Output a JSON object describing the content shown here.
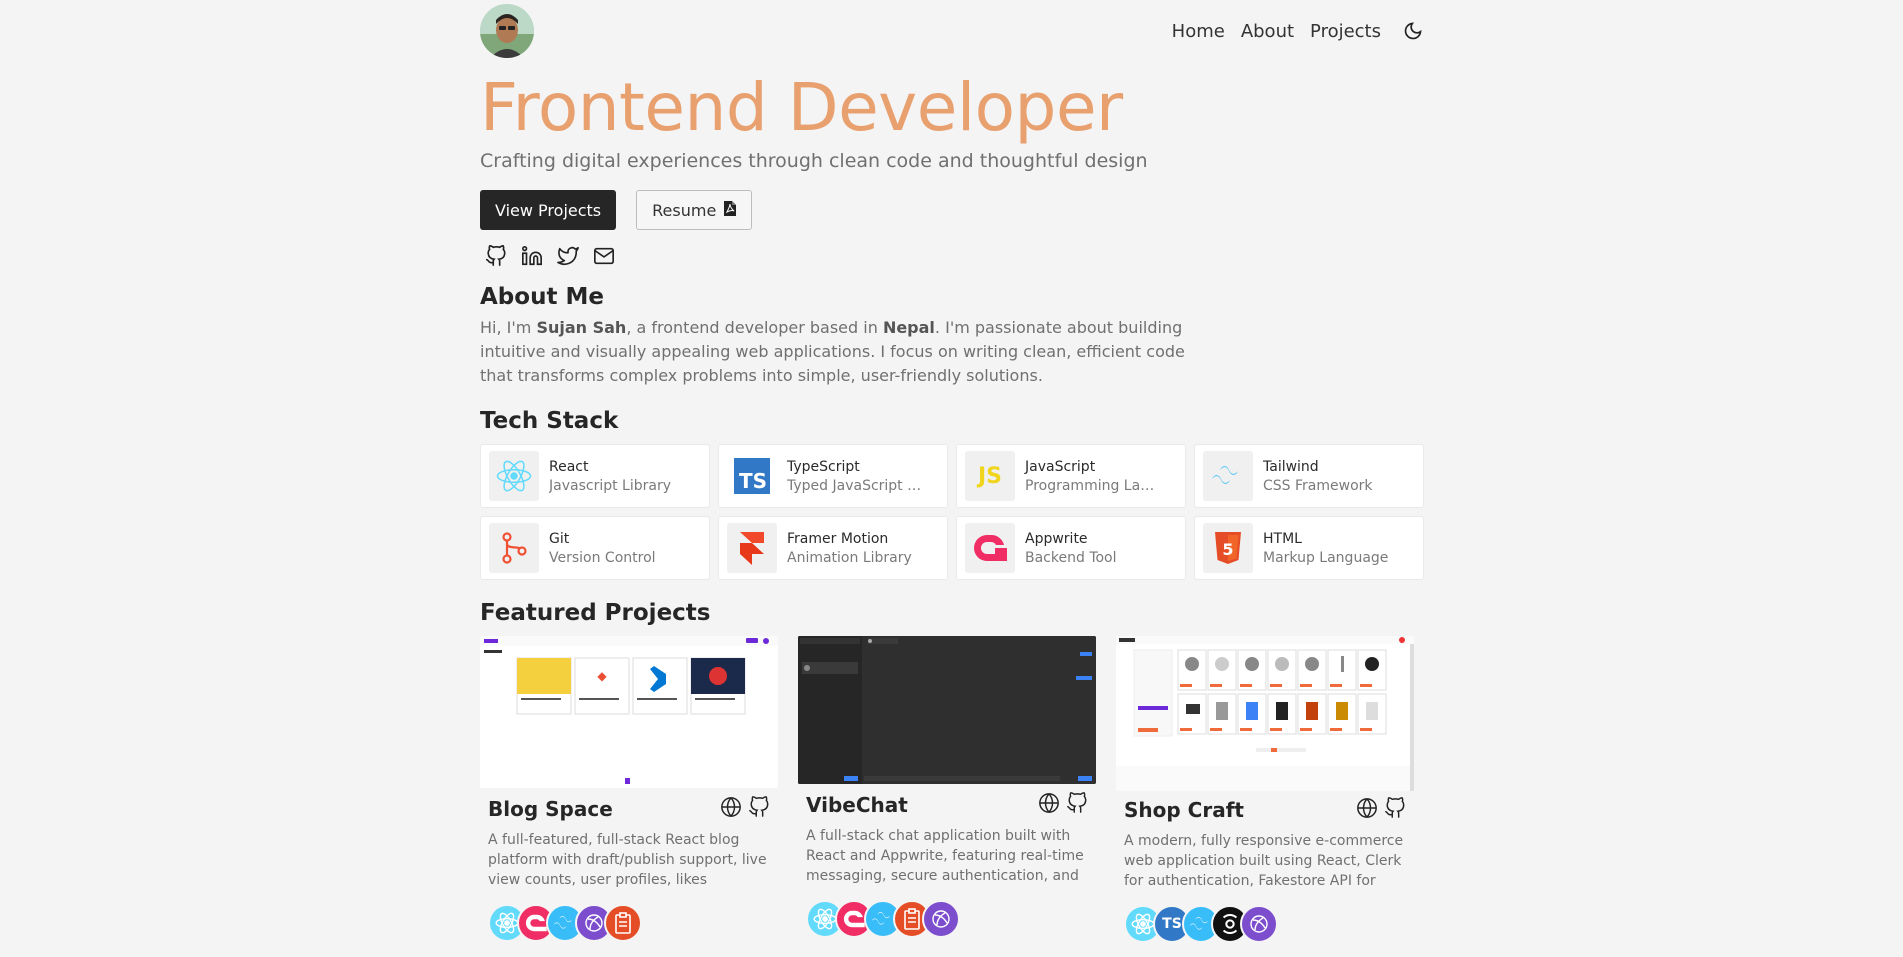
{
  "nav": {
    "links": [
      "Home",
      "About",
      "Projects"
    ],
    "theme_icon": "moon-icon"
  },
  "hero": {
    "title": "Frontend Developer",
    "subtitle": "Crafting digital experiences through clean code and thoughtful design",
    "view_projects": "View Projects",
    "resume": "Resume",
    "social_icons": [
      "github-icon",
      "linkedin-icon",
      "twitter-icon",
      "mail-icon"
    ]
  },
  "about": {
    "heading": "About Me",
    "intro": "Hi, I'm ",
    "name": "Sujan Sah",
    "mid": ", a frontend developer based in ",
    "place": "Nepal",
    "rest": ". I'm passionate about building intuitive and visually appealing web applications. I focus on writing clean, efficient code that transforms complex problems into simple, user-friendly solutions."
  },
  "tech": {
    "heading": "Tech Stack",
    "items": [
      {
        "name": "React",
        "desc": "Javascript Library"
      },
      {
        "name": "TypeScript",
        "desc": "Typed JavaScript Superset"
      },
      {
        "name": "JavaScript",
        "desc": "Programming Language"
      },
      {
        "name": "Tailwind",
        "desc": "CSS Framework"
      },
      {
        "name": "Git",
        "desc": "Version Control"
      },
      {
        "name": "Framer Motion",
        "desc": "Animation Library"
      },
      {
        "name": "Appwrite",
        "desc": "Backend Tool"
      },
      {
        "name": "HTML",
        "desc": "Markup Language"
      }
    ],
    "icon_labels": {
      "ts": "TS",
      "js": "JS",
      "html": "5"
    }
  },
  "projects": {
    "heading": "Featured Projects",
    "items": [
      {
        "title": "Blog Space",
        "desc": "A full-featured, full-stack React blog platform with draft/publish support, live view counts, user profiles, likes system,…"
      },
      {
        "title": "VibeChat",
        "desc": "A full-stack chat application built with React and Appwrite, featuring real-time messaging, secure authentication, and use…"
      },
      {
        "title": "Shop Craft",
        "desc": "A modern, fully responsive e-commerce web application built using React, Clerk for authentication, Fakestore API for product…"
      }
    ],
    "stack_labels": {
      "ts": "TS"
    }
  },
  "colors": {
    "accent": "#e8a06f",
    "react": "#61dafb",
    "appwrite": "#f02e65",
    "tailwind": "#38bdf8",
    "framer": "#7c4dcc",
    "html": "#e44d26"
  }
}
